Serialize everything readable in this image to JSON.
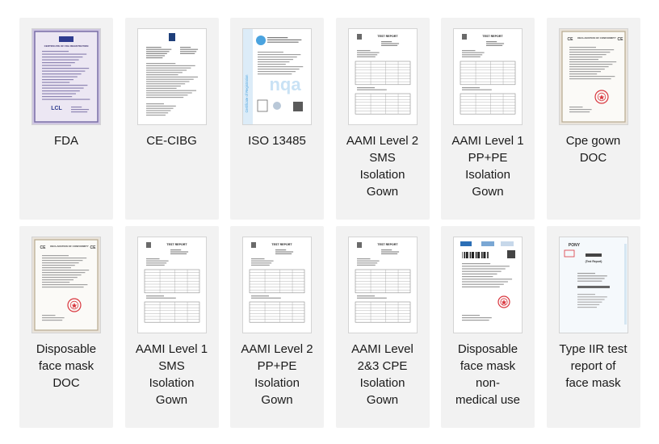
{
  "certificates": [
    {
      "label": "FDA",
      "style": "fda",
      "heading": "CERTIFICATE OF FDA REGISTRATION"
    },
    {
      "label": "CE-CIBG",
      "style": "letter",
      "heading": ""
    },
    {
      "label": "ISO 13485",
      "style": "iso",
      "heading": "Certificate of Registration"
    },
    {
      "label": "AAMI Level 2\nSMS\nIsolation\nGown",
      "style": "report",
      "heading": "TEST REPORT"
    },
    {
      "label": "AAMI Level 1\nPP+PE\nIsolation\nGown",
      "style": "report",
      "heading": "TEST REPORT"
    },
    {
      "label": "Cpe gown\nDOC",
      "style": "doc",
      "heading": "DECLARATION OF CONFORMITY"
    },
    {
      "label": "Disposable\nface mask\nDOC",
      "style": "doc",
      "heading": "DECLARATION OF CONFORMITY"
    },
    {
      "label": "AAMI Level 1\nSMS\nIsolation\nGown",
      "style": "report",
      "heading": "TEST REPORT"
    },
    {
      "label": "AAMI Level 2\nPP+PE\nIsolation\nGown",
      "style": "report",
      "heading": "TEST REPORT"
    },
    {
      "label": "AAMI Level\n2&3 CPE\nIsolation\nGown",
      "style": "report",
      "heading": "TEST REPORT"
    },
    {
      "label": "Disposable\nface mask\nnon-\nmedical use",
      "style": "test",
      "heading": ""
    },
    {
      "label": "Type IIR test\nreport of\nface mask",
      "style": "pony",
      "heading": "(Test Report)"
    }
  ],
  "colors": {
    "card_bg": "#f2f2f2",
    "caption_text": "#1a1a1a",
    "stamp_red": "#d9363e",
    "iso_blue": "#4aa3df",
    "fda_purple": "#7a6fa8"
  }
}
